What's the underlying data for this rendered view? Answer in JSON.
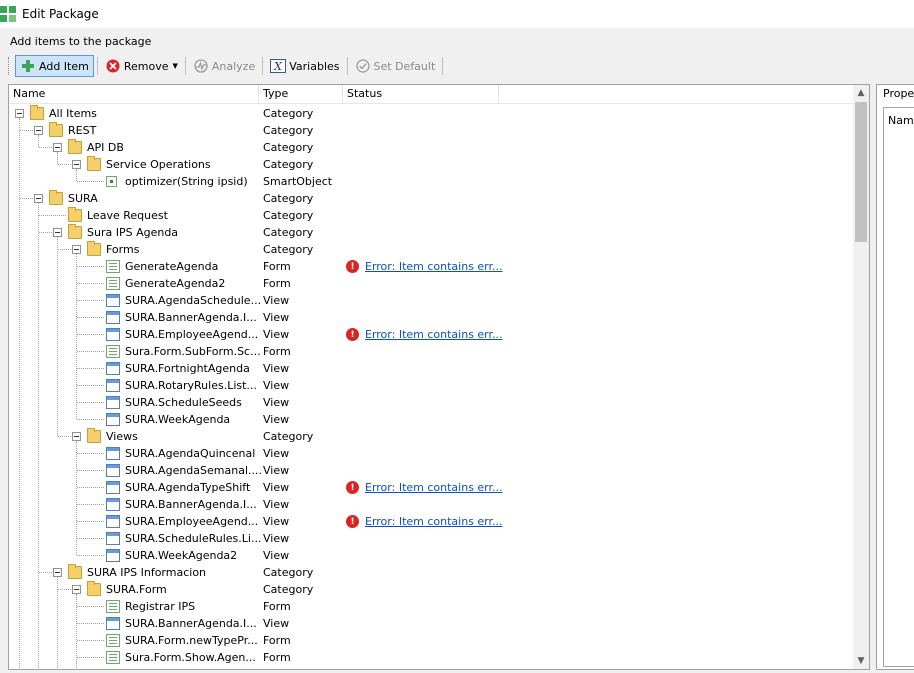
{
  "window": {
    "title": "Edit Package"
  },
  "subtitle": "Add items to the package",
  "toolbar": {
    "add_item": "Add Item",
    "remove": "Remove",
    "analyze": "Analyze",
    "variables": "Variables",
    "set_default": "Set Default"
  },
  "columns": {
    "name": "Name",
    "type": "Type",
    "status": "Status"
  },
  "properties": {
    "title": "Properties",
    "name_label": "Name"
  },
  "tree": [
    {
      "label": "All Items",
      "type": "Category",
      "icon": "folder-icon",
      "depth": 0,
      "expandable": true,
      "status": ""
    },
    {
      "label": "REST",
      "type": "Category",
      "icon": "folder-icon",
      "depth": 1,
      "expandable": true,
      "status": ""
    },
    {
      "label": "API DB",
      "type": "Category",
      "icon": "folder-icon",
      "depth": 2,
      "expandable": true,
      "status": ""
    },
    {
      "label": "Service Operations",
      "type": "Category",
      "icon": "folder-icon",
      "depth": 3,
      "expandable": true,
      "status": ""
    },
    {
      "label": "optimizer(String ipsid)",
      "type": "SmartObject",
      "icon": "smartobject-icon",
      "depth": 4,
      "expandable": false,
      "status": ""
    },
    {
      "label": "SURA",
      "type": "Category",
      "icon": "folder-icon",
      "depth": 1,
      "expandable": true,
      "status": ""
    },
    {
      "label": "Leave Request",
      "type": "Category",
      "icon": "folder-icon",
      "depth": 2,
      "expandable": false,
      "status": ""
    },
    {
      "label": "Sura IPS Agenda",
      "type": "Category",
      "icon": "folder-icon",
      "depth": 2,
      "expandable": true,
      "status": ""
    },
    {
      "label": "Forms",
      "type": "Category",
      "icon": "folder-icon",
      "depth": 3,
      "expandable": true,
      "status": ""
    },
    {
      "label": "GenerateAgenda",
      "type": "Form",
      "icon": "form-icon",
      "depth": 4,
      "expandable": false,
      "status": "Error: Item contains err..."
    },
    {
      "label": "GenerateAgenda2",
      "type": "Form",
      "icon": "form-icon",
      "depth": 4,
      "expandable": false,
      "status": ""
    },
    {
      "label": "SURA.AgendaSchedule...",
      "type": "View",
      "icon": "view-icon",
      "depth": 4,
      "expandable": false,
      "status": ""
    },
    {
      "label": "SURA.BannerAgenda.I...",
      "type": "View",
      "icon": "view-icon",
      "depth": 4,
      "expandable": false,
      "status": ""
    },
    {
      "label": "SURA.EmployeeAgend...",
      "type": "View",
      "icon": "view-icon",
      "depth": 4,
      "expandable": false,
      "status": "Error: Item contains err..."
    },
    {
      "label": "Sura.Form.SubForm.Sc...",
      "type": "Form",
      "icon": "form-icon",
      "depth": 4,
      "expandable": false,
      "status": ""
    },
    {
      "label": "SURA.FortnightAgenda",
      "type": "View",
      "icon": "view-icon",
      "depth": 4,
      "expandable": false,
      "status": ""
    },
    {
      "label": "SURA.RotaryRules.List...",
      "type": "View",
      "icon": "view-icon",
      "depth": 4,
      "expandable": false,
      "status": ""
    },
    {
      "label": "SURA.ScheduleSeeds",
      "type": "View",
      "icon": "view-icon",
      "depth": 4,
      "expandable": false,
      "status": ""
    },
    {
      "label": "SURA.WeekAgenda",
      "type": "View",
      "icon": "view-icon",
      "depth": 4,
      "expandable": false,
      "status": ""
    },
    {
      "label": "Views",
      "type": "Category",
      "icon": "folder-icon",
      "depth": 3,
      "expandable": true,
      "status": ""
    },
    {
      "label": "SURA.AgendaQuincenal",
      "type": "View",
      "icon": "view-icon",
      "depth": 4,
      "expandable": false,
      "status": ""
    },
    {
      "label": "SURA.AgendaSemanal....",
      "type": "View",
      "icon": "view-icon",
      "depth": 4,
      "expandable": false,
      "status": ""
    },
    {
      "label": "SURA.AgendaTypeShift",
      "type": "View",
      "icon": "view-icon",
      "depth": 4,
      "expandable": false,
      "status": "Error: Item contains err..."
    },
    {
      "label": "SURA.BannerAgenda.I...",
      "type": "View",
      "icon": "view-icon",
      "depth": 4,
      "expandable": false,
      "status": ""
    },
    {
      "label": "SURA.EmployeeAgend...",
      "type": "View",
      "icon": "view-icon",
      "depth": 4,
      "expandable": false,
      "status": "Error: Item contains err..."
    },
    {
      "label": "SURA.ScheduleRules.Li...",
      "type": "View",
      "icon": "view-icon",
      "depth": 4,
      "expandable": false,
      "status": ""
    },
    {
      "label": "SURA.WeekAgenda2",
      "type": "View",
      "icon": "view-icon",
      "depth": 4,
      "expandable": false,
      "status": ""
    },
    {
      "label": "SURA IPS Informacion",
      "type": "Category",
      "icon": "folder-icon",
      "depth": 2,
      "expandable": true,
      "status": ""
    },
    {
      "label": "SURA.Form",
      "type": "Category",
      "icon": "folder-icon",
      "depth": 3,
      "expandable": true,
      "status": ""
    },
    {
      "label": "Registrar IPS",
      "type": "Form",
      "icon": "form-icon",
      "depth": 4,
      "expandable": false,
      "status": ""
    },
    {
      "label": "SURA.BannerAgenda.I...",
      "type": "View",
      "icon": "view-icon",
      "depth": 4,
      "expandable": false,
      "status": ""
    },
    {
      "label": "SURA.Form.newTypePr...",
      "type": "Form",
      "icon": "form-icon",
      "depth": 4,
      "expandable": false,
      "status": ""
    },
    {
      "label": "Sura.Form.Show.Agen...",
      "type": "Form",
      "icon": "form-icon",
      "depth": 4,
      "expandable": false,
      "status": ""
    }
  ],
  "colors": {
    "accent": "#0b4fc4",
    "error": "#d92525",
    "folder": "#f5cf6a",
    "selected_button": "#cce4f7"
  }
}
